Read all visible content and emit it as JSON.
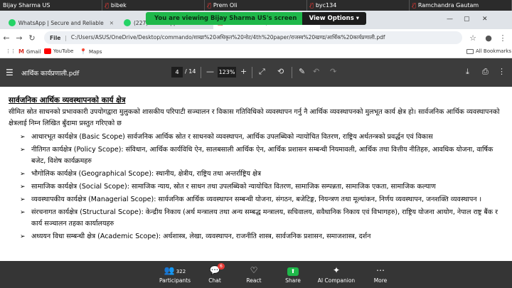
{
  "meeting": {
    "participants": [
      {
        "name": "Bijay Sharma US",
        "muted": false
      },
      {
        "name": "bibek",
        "muted": true
      },
      {
        "name": "Prem Oli",
        "muted": true
      },
      {
        "name": "byc134",
        "muted": true
      },
      {
        "name": "Ramchandra Gautam",
        "muted": true
      }
    ],
    "share_banner": "You are viewing  Bijay Sharma US's screen",
    "view_options": "View Options",
    "bottom_bar": {
      "participants_label": "Participants",
      "participants_count": "322",
      "chat_label": "Chat",
      "chat_badge": "6",
      "react_label": "React",
      "share_label": "Share",
      "companion_label": "AI Companion",
      "more_label": "More"
    }
  },
  "browser": {
    "tabs": [
      {
        "title": "WhatsApp | Secure and Reliable"
      },
      {
        "title": "(227) WhatsApp"
      },
      {
        "title": "आर्थिक कार्यप्रणाली.pdf"
      }
    ],
    "address": {
      "scheme_label": "File",
      "url": "C:/Users/ASUS/OneDrive/Desktop/commando/शाखा%20अधिकृत%20नोट/4th%20paper/राजस्व%20खण्ड/आर्थिक%20कार्यप्रणाली.pdf"
    },
    "bookmarks": [
      {
        "label": "Gmail"
      },
      {
        "label": "YouTube"
      },
      {
        "label": "Maps"
      }
    ],
    "all_bookmarks": "All Bookmarks"
  },
  "pdf": {
    "filename": "आर्थिक कार्यप्रणाली.pdf",
    "page_current": "4",
    "page_total": "/ 14",
    "zoom": "123%"
  },
  "document": {
    "title": "सार्वजनिक आर्थिक व्यवस्थापनको कार्य क्षेत्र",
    "intro": "सीमित स्रोत साधनको प्रभावकारी उपयोगद्वारा मुलुकको शासकीय परिपाटी सञ्चालन र विकास गतिविधिको व्यवस्थापन गर्नु नै आर्थिक व्यवस्थापनको मुलभूत कार्य क्षेत्र हो। सार्वजनिक आर्थिक व्यवस्थापनको क्षेत्रलाई निम्न लिखित बुँदामा प्रस्तुत गरिएको छ",
    "items": [
      "आधारभूत कार्यक्षेत्र (Basic Scope) सार्वजनिक आर्थिक स्रोत र साधनको व्यवस्थापन, आर्थिक उपलब्धिको न्यायोचित वितरण, राष्ट्रिय अर्थतन्त्रको प्रवर्द्धन एवं विकास",
      "नीतिगत कार्यक्षेत्र (Policy Scope): संविधान, आर्थिक कार्यविधि ऐन, सालबसाली आर्थिक ऐन, आर्थिक प्रशासन सम्बन्धी नियमावली, आर्थिक तथा वित्तीय नीतिहरु, आवधिक योजना, वार्षिक बजेट, विशेष कार्यक्रमहरु",
      "भौगोलिक कार्यक्षेत्र (Geographical Scope): स्थानीय, क्षेत्रीय, राष्ट्रिय तथा अन्तर्राष्ट्रिय क्षेत्र",
      "सामाजिक कार्यक्षेत्र (Social Scope): सामाजिक न्याय, स्रोत र साधन तथा उपलब्धिको न्यायोचित वितरण, सामाजिक सम्पन्नता, सामाजिक एकता, सामाजिक कल्याण",
      "व्यवस्थापकीय कार्यक्षेत्र (Managerial Scope): सार्वजनिक आर्थिक व्यवस्थापन सम्बन्धी योजना, संगठन, बजेटिङ्ग, नियन्त्रण तथा मूल्यांकन, निर्णय व्यवस्थापन, जनशक्ति व्यवस्थापन ।",
      "संरचनागत कार्यक्षेत्र (Structural Scope): केन्द्रीय निकाय (अर्थ मन्त्रालय तथा अन्य सम्बद्ध मन्त्रालय, सचिवालय, सवैधानिक निकाय एवं विभागहरु), राष्ट्रिय योजना आयोग, नेपाल राष्ट्र बैंक र कार्य सञ्चालन तहका कार्यालयहरु",
      "अध्ययन विधा सम्बन्धी क्षेत्र (Academic Scope): अर्थशास्त्र, लेखा, व्यवस्थापन, राजनीति शास्त्र, सार्वजनिक प्रशासन, समाजशास्त्र, दर्शन"
    ]
  }
}
